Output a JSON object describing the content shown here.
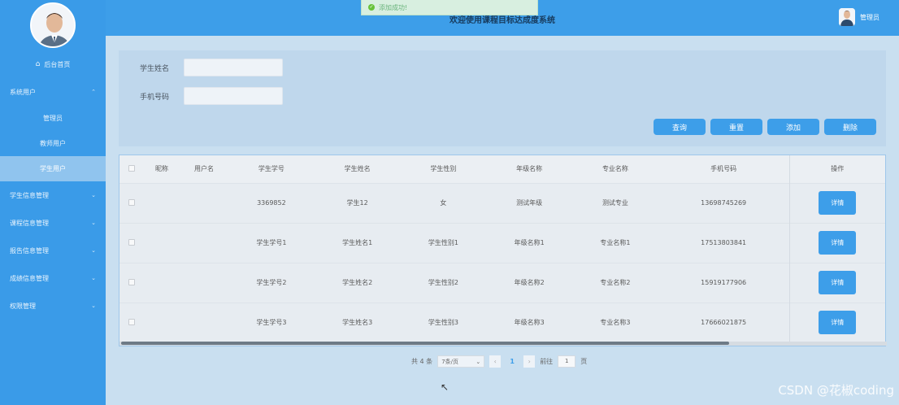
{
  "header": {
    "title": "欢迎使用课程目标达成度系统",
    "user_name": "管理员"
  },
  "toast": {
    "message": "添加成功!"
  },
  "sidebar": {
    "items": [
      {
        "label": "后台首页"
      },
      {
        "label": "系统用户"
      },
      {
        "label": "管理员"
      },
      {
        "label": "教师用户"
      },
      {
        "label": "学生用户"
      },
      {
        "label": "学生信息管理"
      },
      {
        "label": "课程信息管理"
      },
      {
        "label": "报告信息管理"
      },
      {
        "label": "成绩信息管理"
      },
      {
        "label": "权限管理"
      }
    ]
  },
  "search": {
    "name_label": "学生姓名",
    "phone_label": "手机号码",
    "name_value": "",
    "phone_value": ""
  },
  "buttons": {
    "query": "查询",
    "reset": "重置",
    "add": "添加",
    "delete": "删除"
  },
  "table": {
    "headers": [
      "昵称",
      "用户名",
      "学生学号",
      "学生姓名",
      "学生性别",
      "年级名称",
      "专业名称",
      "手机号码",
      "操作"
    ],
    "detail_label": "详情",
    "rows": [
      [
        "",
        "",
        "3369852",
        "学生12",
        "女",
        "测试年级",
        "测试专业",
        "13698745269"
      ],
      [
        "",
        "",
        "学生学号1",
        "学生姓名1",
        "学生性别1",
        "年级名称1",
        "专业名称1",
        "17513803841"
      ],
      [
        "",
        "",
        "学生学号2",
        "学生姓名2",
        "学生性别2",
        "年级名称2",
        "专业名称2",
        "15919177906"
      ],
      [
        "",
        "",
        "学生学号3",
        "学生姓名3",
        "学生性别3",
        "年级名称3",
        "专业名称3",
        "17666021875"
      ]
    ]
  },
  "pagination": {
    "total": "共 4 条",
    "page_size": "7条/页",
    "current_page": "1",
    "goto_label": "前往",
    "goto_value": "1",
    "page_suffix": "页"
  },
  "watermark": "CSDN @花椒coding",
  "colors": {
    "primary": "#3d9ee9",
    "sidebar": "#3a9be8",
    "success": "#67c23a"
  }
}
